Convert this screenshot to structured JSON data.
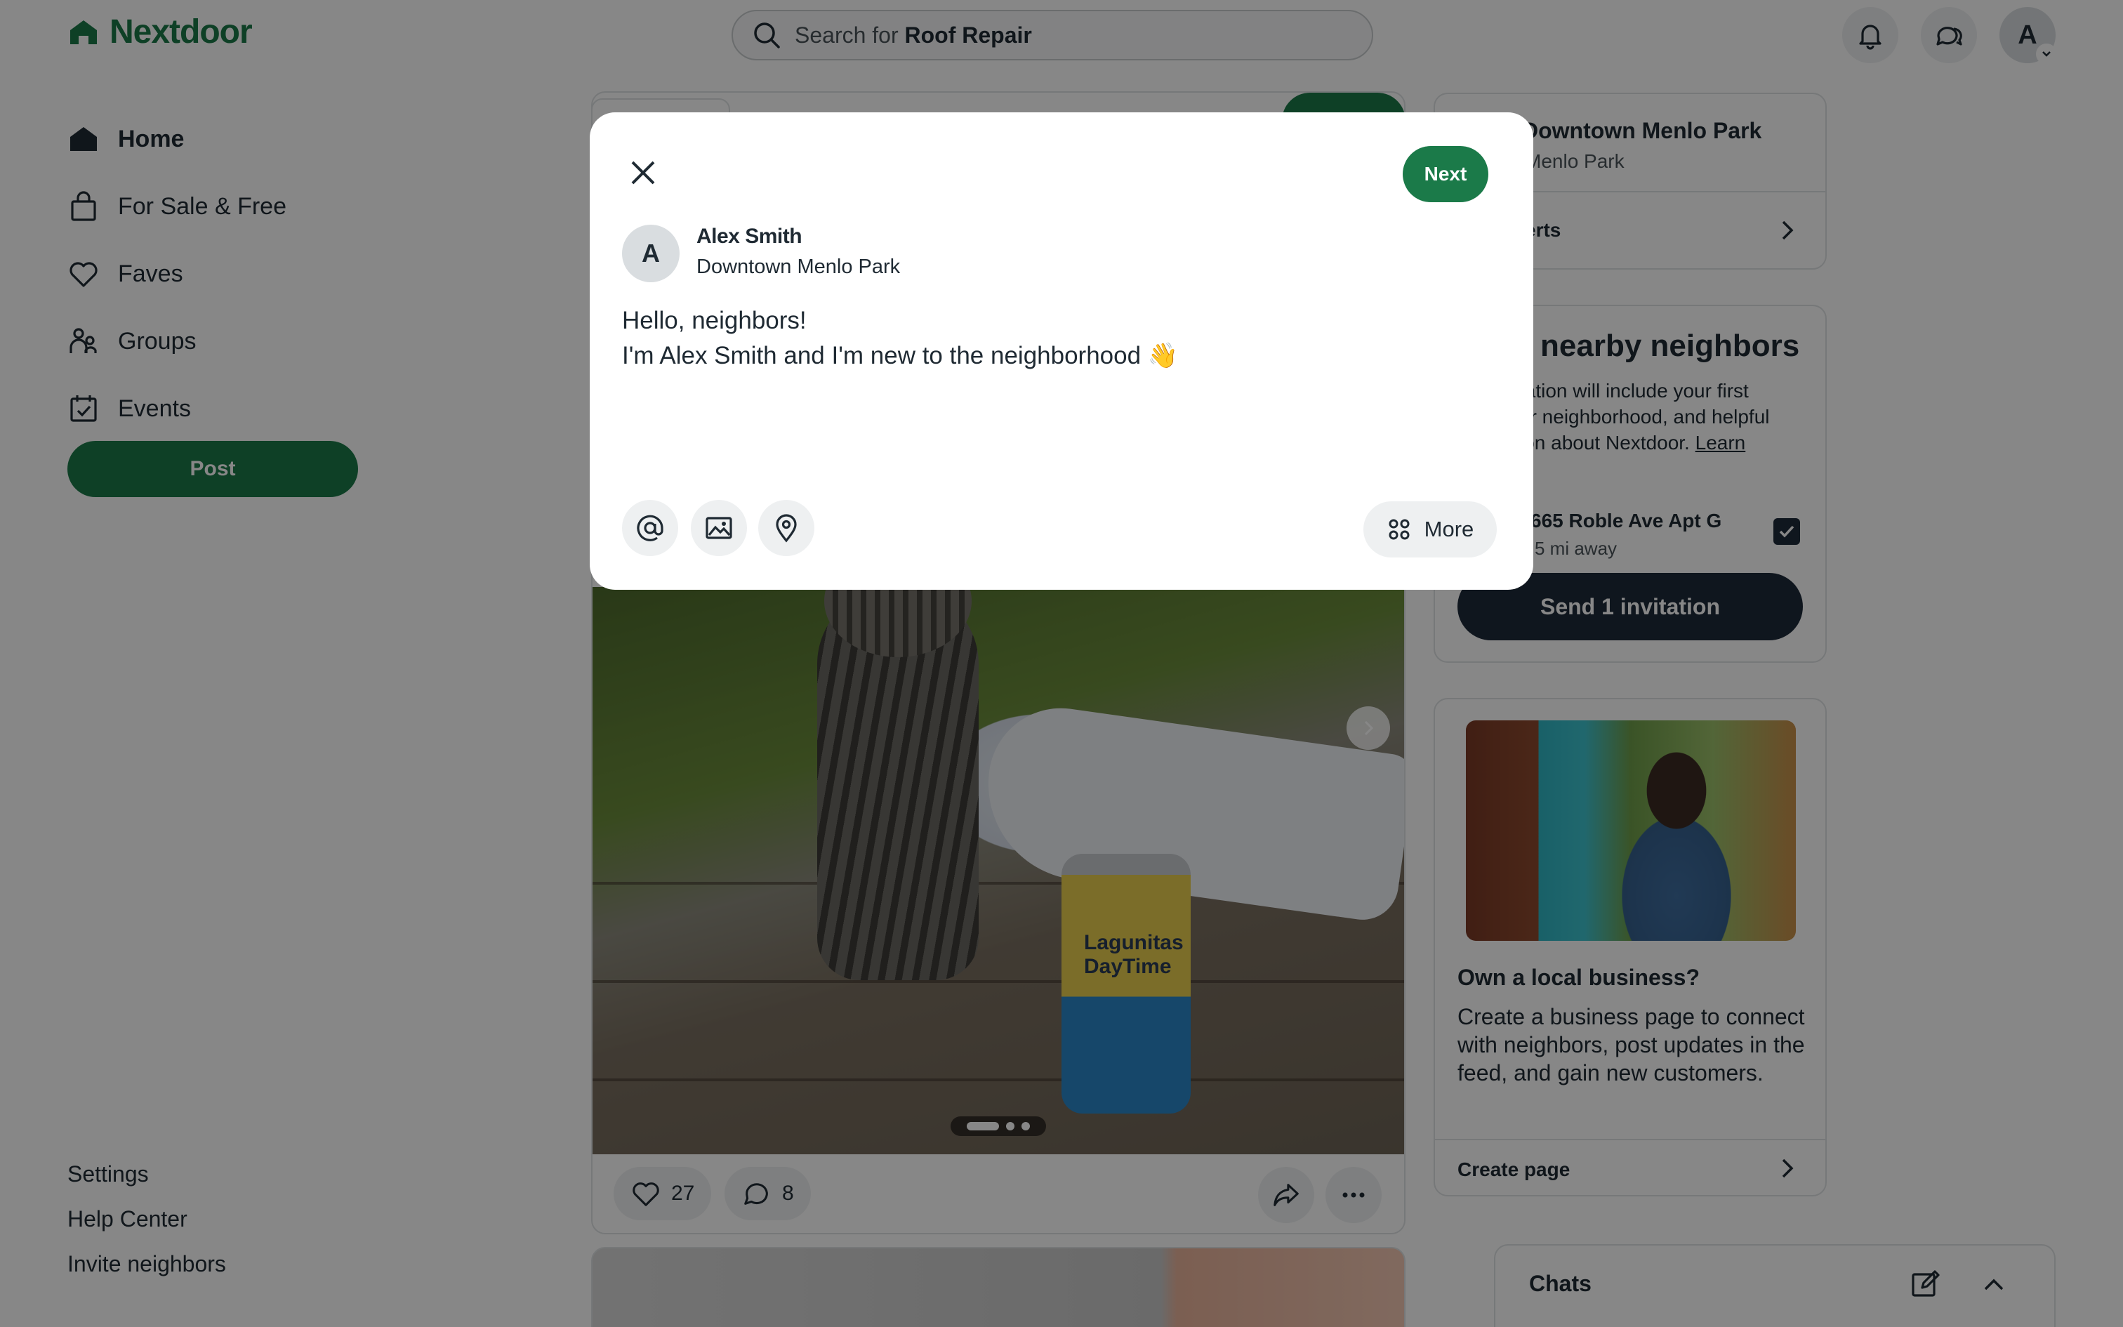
{
  "brand": {
    "name": "Nextdoor",
    "color": "#1b7a49"
  },
  "search": {
    "prefix": "Search for",
    "term": "Roof Repair"
  },
  "header": {
    "avatar_initial": "A"
  },
  "sidebar": {
    "items": [
      {
        "label": "Home",
        "icon": "home-icon",
        "active": true
      },
      {
        "label": "For Sale & Free",
        "icon": "shopping-bag-icon"
      },
      {
        "label": "Faves",
        "icon": "heart-icon"
      },
      {
        "label": "Groups",
        "icon": "groups-icon"
      },
      {
        "label": "Events",
        "icon": "calendar-icon"
      }
    ],
    "post_label": "Post",
    "footer": [
      "Settings",
      "Help Center",
      "Invite neighbors"
    ]
  },
  "feed": {
    "photo_can_text": "Lagunitas DayTime",
    "photo_index": 1,
    "photo_count": 3,
    "likes": "27",
    "comments": "8"
  },
  "right": {
    "hood_card": {
      "title": "Downtown Menlo Park",
      "subtitle": "Menlo Park",
      "link": "erts"
    },
    "invite_card": {
      "title": "nearby neighbors",
      "desc_line1": "tation will include your first",
      "desc_line2": "ur neighborhood, and helpful",
      "desc_line3": "ion about Nextdoor.",
      "learn": "Learn",
      "address": "665 Roble Ave Apt G",
      "distance": "5 mi away",
      "checked": true,
      "button": "Send 1 invitation"
    },
    "biz_card": {
      "title": "Own a local business?",
      "body": "Create a business page to connect with neighbors, post updates in the feed, and gain new customers.",
      "link": "Create page"
    },
    "chats": {
      "title": "Chats"
    }
  },
  "modal": {
    "next_label": "Next",
    "author_initial": "A",
    "author_name": "Alex Smith",
    "author_hood": "Downtown Menlo Park",
    "body_line1": "Hello, neighbors!",
    "body_line2": "I'm Alex Smith and I'm new to the neighborhood 👋",
    "more_label": "More"
  }
}
